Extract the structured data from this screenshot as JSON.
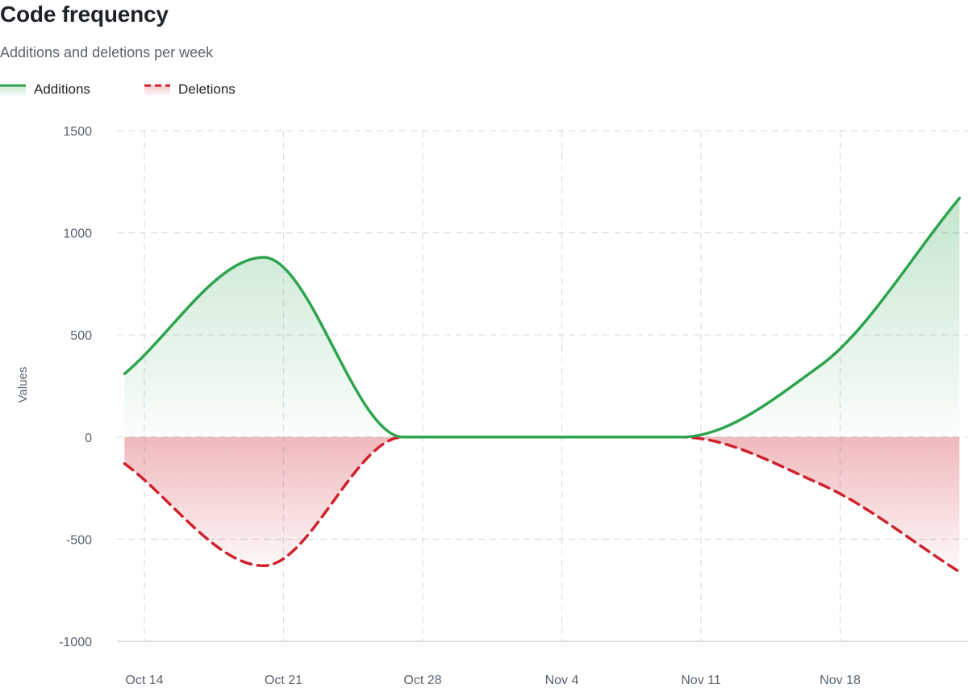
{
  "header": {
    "title": "Code frequency",
    "subtitle": "Additions and deletions per week"
  },
  "legend": {
    "additions_label": "Additions",
    "deletions_label": "Deletions"
  },
  "colors": {
    "additions": "#2da44e",
    "deletions": "#cf222e",
    "grid": "#d8dee4",
    "axis_text": "#59636e"
  },
  "chart_data": {
    "type": "area",
    "ylabel": "Values",
    "ylim": [
      -1000,
      1500
    ],
    "yticks": [
      1500,
      1000,
      500,
      0,
      -500,
      -1000
    ],
    "xticks": [
      {
        "label": "Oct 14",
        "date": "2024-10-14"
      },
      {
        "label": "Oct 21",
        "date": "2024-10-21"
      },
      {
        "label": "Oct 28",
        "date": "2024-10-28"
      },
      {
        "label": "Nov 4",
        "date": "2024-11-04"
      },
      {
        "label": "Nov 11",
        "date": "2024-11-11"
      },
      {
        "label": "Nov 18",
        "date": "2024-11-18"
      }
    ],
    "grid": true,
    "legend_position": "top-left",
    "series": [
      {
        "name": "Additions",
        "style": "solid",
        "points": [
          {
            "date": "2024-10-13",
            "value": 310
          },
          {
            "date": "2024-10-20",
            "value": 880
          },
          {
            "date": "2024-10-27",
            "value": 0
          },
          {
            "date": "2024-11-03",
            "value": 0
          },
          {
            "date": "2024-11-10",
            "value": 0
          },
          {
            "date": "2024-11-17",
            "value": 350
          },
          {
            "date": "2024-11-24",
            "value": 1170
          }
        ]
      },
      {
        "name": "Deletions",
        "style": "dashed",
        "points": [
          {
            "date": "2024-10-13",
            "value": -130
          },
          {
            "date": "2024-10-20",
            "value": -630
          },
          {
            "date": "2024-10-27",
            "value": 0
          },
          {
            "date": "2024-11-03",
            "value": 0
          },
          {
            "date": "2024-11-10",
            "value": 0
          },
          {
            "date": "2024-11-17",
            "value": -230
          },
          {
            "date": "2024-11-24",
            "value": -660
          }
        ]
      }
    ]
  }
}
